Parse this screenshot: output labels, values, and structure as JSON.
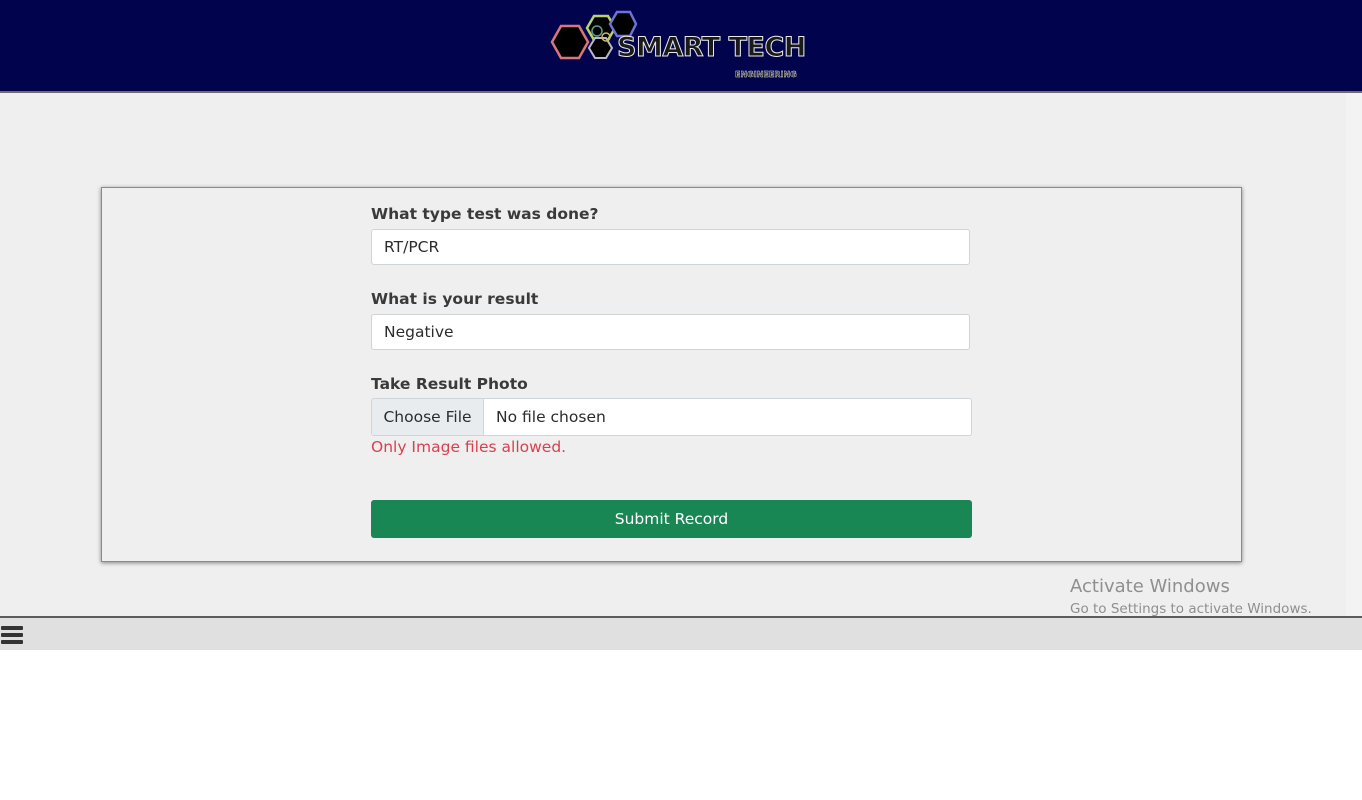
{
  "brand": {
    "name": "SMART TECH",
    "tagline": "ENGINEERING"
  },
  "form": {
    "test_type": {
      "label": "What type test was done?",
      "value": "RT/PCR"
    },
    "result": {
      "label": "What is your result",
      "value": "Negative"
    },
    "photo": {
      "label": "Take Result Photo",
      "button_label": "Choose File",
      "file_status": "No file chosen",
      "error": "Only Image files allowed."
    },
    "submit_label": "Submit Record"
  },
  "watermark": {
    "title": "Activate Windows",
    "subtitle": "Go to Settings to activate Windows."
  },
  "bottom_bar": {
    "menu_icon": "hamburger-menu-icon"
  },
  "colors": {
    "header_bg": "#02034d",
    "page_bg": "#efefef",
    "submit_bg": "#198754",
    "error_text": "#d9404f"
  }
}
